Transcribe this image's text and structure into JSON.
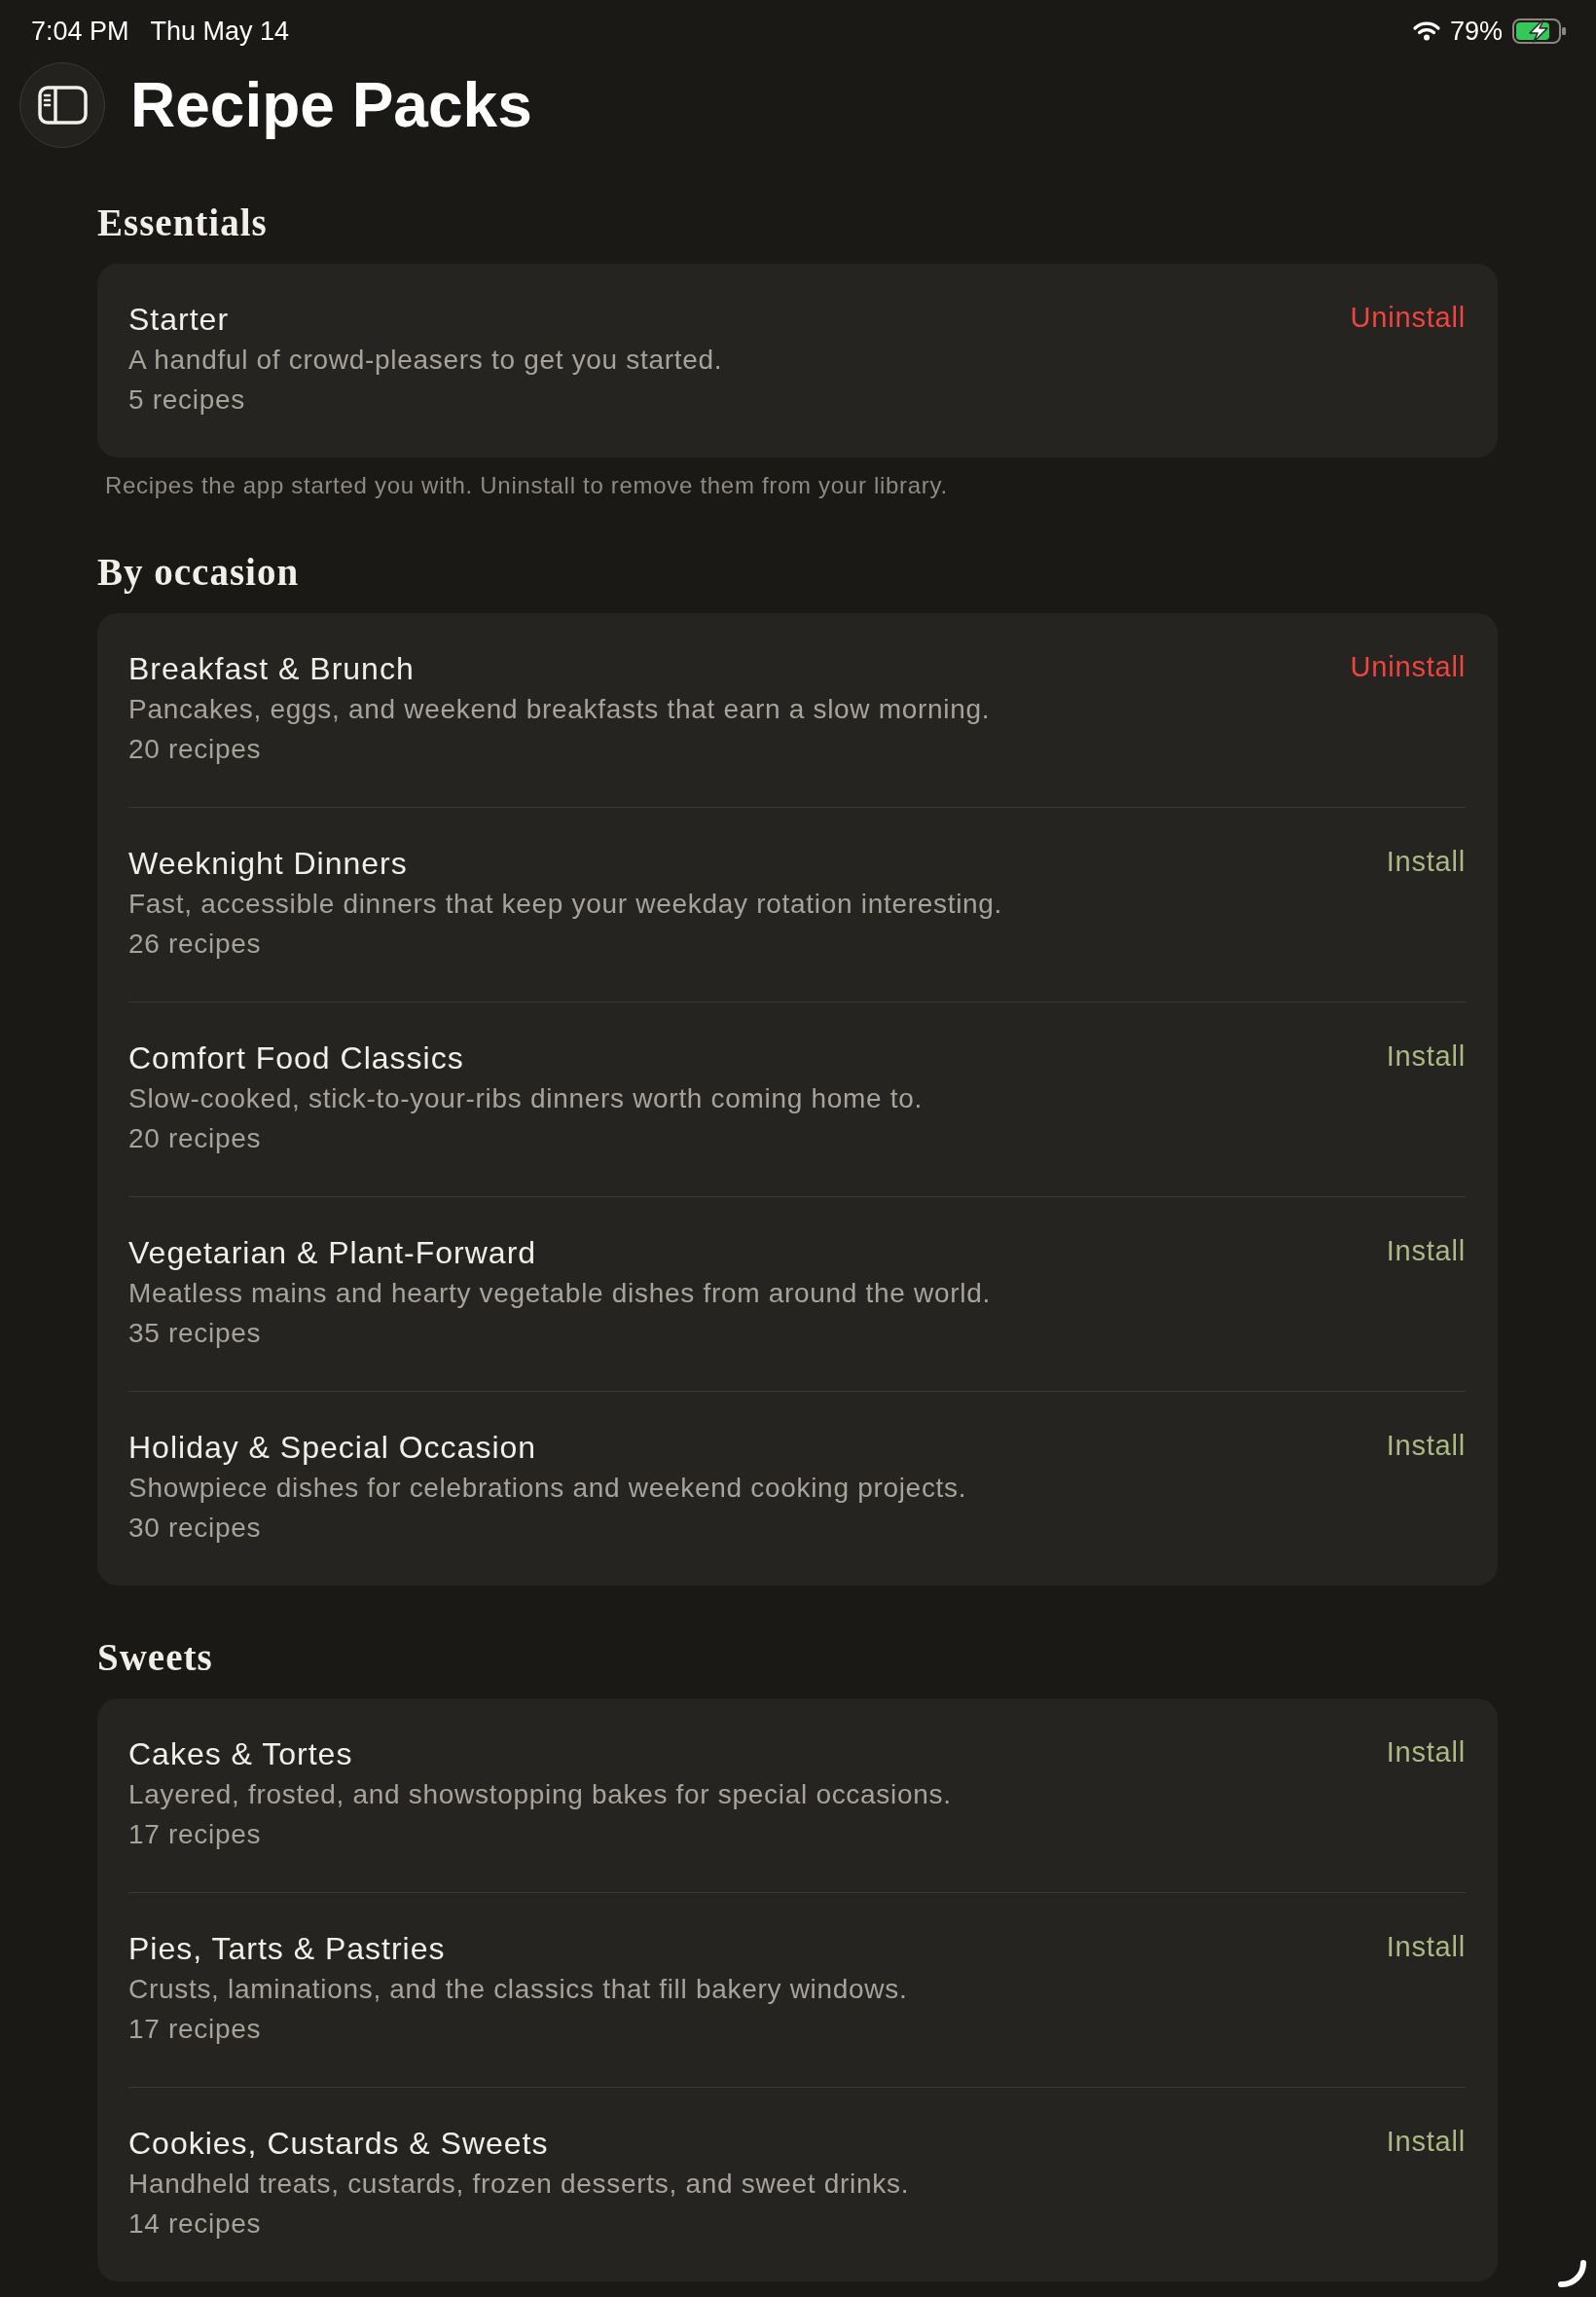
{
  "status_bar": {
    "time": "7:04 PM",
    "date": "Thu May 14",
    "battery": "79%",
    "charging": true
  },
  "header": {
    "title": "Recipe Packs"
  },
  "sections": [
    {
      "title": "Essentials",
      "packs": [
        {
          "name": "Starter",
          "description": "A handful of crowd-pleasers to get you started.",
          "count": "5 recipes",
          "installed": true,
          "action": "Uninstall"
        }
      ],
      "footnote": "Recipes the app started you with. Uninstall to remove them from your library."
    },
    {
      "title": "By occasion",
      "packs": [
        {
          "name": "Breakfast & Brunch",
          "description": "Pancakes, eggs, and weekend breakfasts that earn a slow morning.",
          "count": "20 recipes",
          "installed": true,
          "action": "Uninstall"
        },
        {
          "name": "Weeknight Dinners",
          "description": "Fast, accessible dinners that keep your weekday rotation interesting.",
          "count": "26 recipes",
          "installed": false,
          "action": "Install"
        },
        {
          "name": "Comfort Food Classics",
          "description": "Slow-cooked, stick-to-your-ribs dinners worth coming home to.",
          "count": "20 recipes",
          "installed": false,
          "action": "Install"
        },
        {
          "name": "Vegetarian & Plant-Forward",
          "description": "Meatless mains and hearty vegetable dishes from around the world.",
          "count": "35 recipes",
          "installed": false,
          "action": "Install"
        },
        {
          "name": "Holiday & Special Occasion",
          "description": "Showpiece dishes for celebrations and weekend cooking projects.",
          "count": "30 recipes",
          "installed": false,
          "action": "Install"
        }
      ]
    },
    {
      "title": "Sweets",
      "packs": [
        {
          "name": "Cakes & Tortes",
          "description": "Layered, frosted, and showstopping bakes for special occasions.",
          "count": "17 recipes",
          "installed": false,
          "action": "Install"
        },
        {
          "name": "Pies, Tarts & Pastries",
          "description": "Crusts, laminations, and the classics that fill bakery windows.",
          "count": "17 recipes",
          "installed": false,
          "action": "Install"
        },
        {
          "name": "Cookies, Custards & Sweets",
          "description": "Handheld treats, custards, frozen desserts, and sweet drinks.",
          "count": "14 recipes",
          "installed": false,
          "action": "Install"
        }
      ]
    }
  ]
}
